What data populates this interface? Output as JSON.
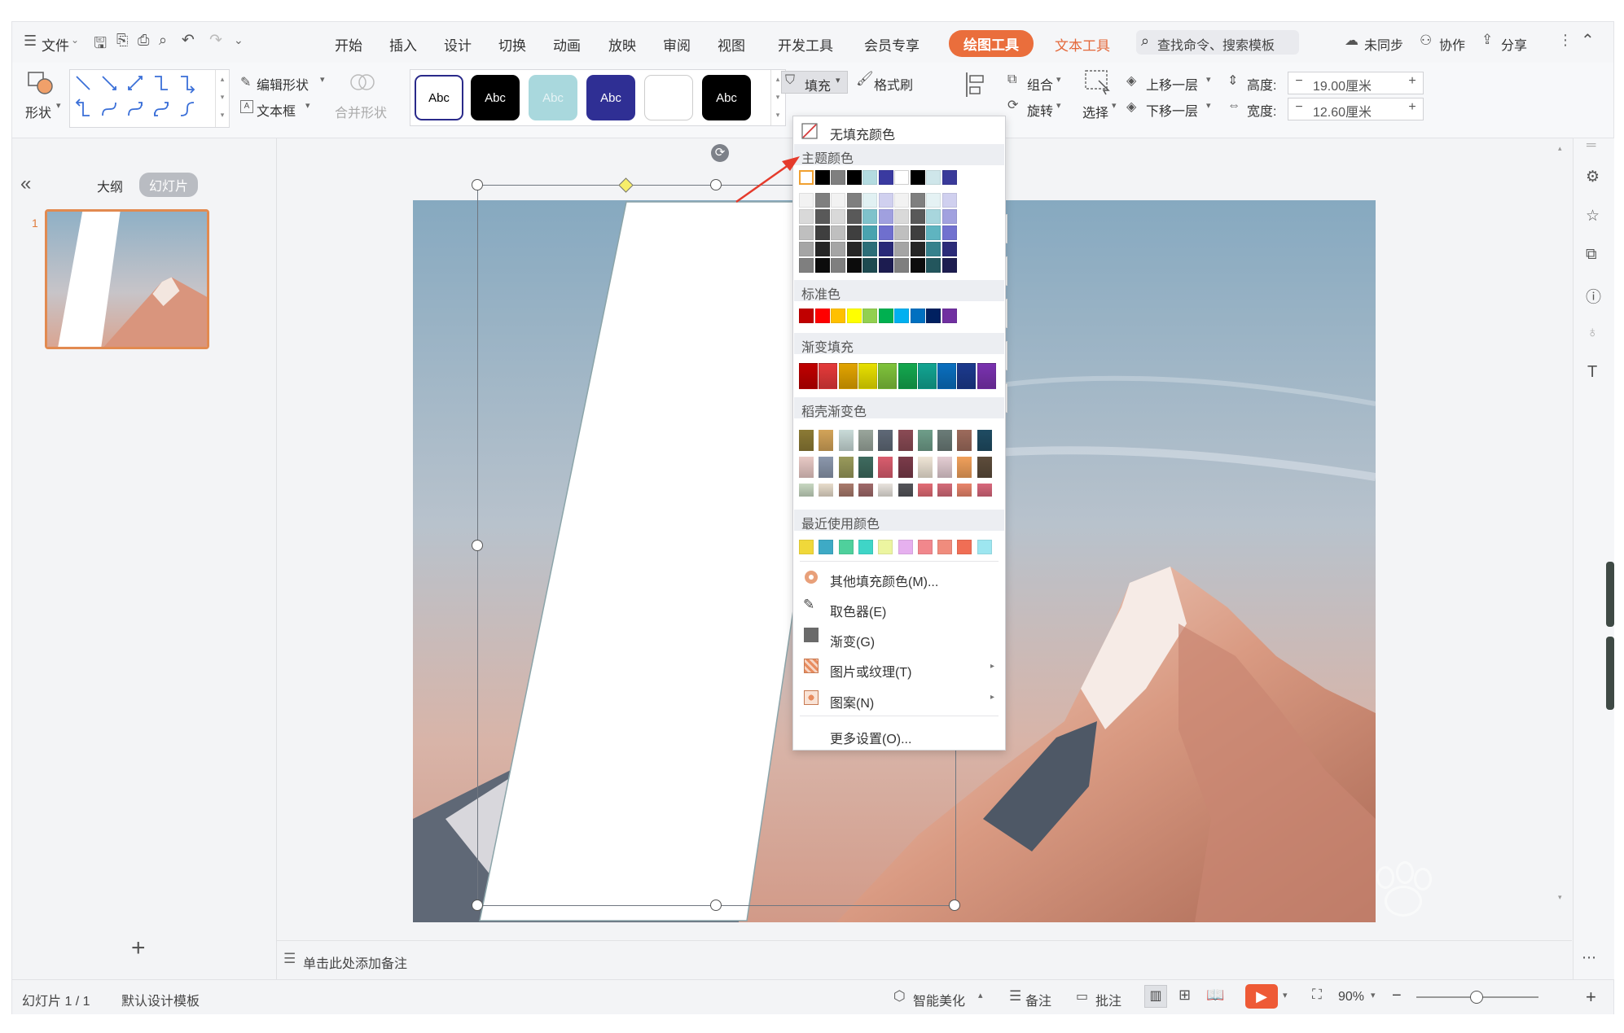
{
  "menubar": {
    "file": "文件",
    "tabs": [
      "开始",
      "插入",
      "设计",
      "切换",
      "动画",
      "放映",
      "审阅",
      "视图",
      "开发工具",
      "会员专享"
    ],
    "drawing_tools": "绘图工具",
    "text_tools": "文本工具",
    "search_placeholder": "查找命令、搜索模板",
    "sync": "未同步",
    "collab": "协作",
    "share": "分享"
  },
  "ribbon": {
    "shape": "形状",
    "edit_shape": "编辑形状",
    "textbox": "文本框",
    "merge_shape": "合并形状",
    "style_label": "Abc",
    "fill": "填充",
    "format_painter": "格式刷",
    "group": "组合",
    "rotate": "旋转",
    "select": "选择",
    "bring_forward": "上移一层",
    "send_backward": "下移一层",
    "height_label": "高度:",
    "height_value": "19.00厘米",
    "width_label": "宽度:",
    "width_value": "12.60厘米",
    "minus": "−",
    "plus": "+"
  },
  "leftpanel": {
    "collapse": "«",
    "outline_tab": "大纲",
    "slides_tab": "幻灯片",
    "slide_number": "1",
    "add": "+"
  },
  "notes_placeholder": "单击此处添加备注",
  "statusbar": {
    "slide_counter": "幻灯片 1 / 1",
    "template": "默认设计模板",
    "smart_beautify": "智能美化",
    "notes": "备注",
    "comments": "批注",
    "zoom": "90%",
    "zoom_minus": "−",
    "zoom_plus": "+"
  },
  "fill_menu": {
    "no_fill": "无填充颜色",
    "theme_colors": "主题颜色",
    "standard_colors": "标准色",
    "gradient_fill": "渐变填充",
    "docer_gradient": "稻壳渐变色",
    "recent_colors": "最近使用颜色",
    "more_colors": "其他填充颜色(M)...",
    "eyedropper": "取色器(E)",
    "gradient": "渐变(G)",
    "picture_texture": "图片或纹理(T)",
    "pattern": "图案(N)",
    "more_settings": "更多设置(O)...",
    "theme_row": [
      "#ffffff",
      "#000000",
      "#7f7f7f",
      "#000000",
      "#b3dbe0",
      "#3a3aa0",
      "#ffffff",
      "#000000",
      "#cfe6ea",
      "#3a3a9a"
    ],
    "theme_shades": [
      [
        "#f2f2f2",
        "#7f7f7f",
        "#f2f2f2",
        "#7f7f7f",
        "#e1f1f3",
        "#d0d0ef",
        "#f2f2f2",
        "#7f7f7f",
        "#e5f2f4",
        "#d0d0ef"
      ],
      [
        "#d9d9d9",
        "#595959",
        "#d9d9d9",
        "#595959",
        "#7fc2cb",
        "#a0a0df",
        "#d9d9d9",
        "#595959",
        "#a8d6dd",
        "#a1a1df"
      ],
      [
        "#bfbfbf",
        "#3f3f3f",
        "#bfbfbf",
        "#3f3f3f",
        "#4aa3af",
        "#6f6fce",
        "#bfbfbf",
        "#3f3f3f",
        "#5fb4c0",
        "#7171cf"
      ],
      [
        "#a5a5a5",
        "#262626",
        "#a5a5a5",
        "#262626",
        "#2c6e78",
        "#2a2a78",
        "#a5a5a5",
        "#262626",
        "#36818c",
        "#2b2b78"
      ],
      [
        "#7f7f7f",
        "#0c0c0c",
        "#7f7f7f",
        "#0c0c0c",
        "#1d4a50",
        "#1c1c50",
        "#7f7f7f",
        "#0c0c0c",
        "#23565d",
        "#1d1d50"
      ]
    ],
    "standard_row": [
      "#c00000",
      "#ff0000",
      "#ffc000",
      "#ffff00",
      "#92d050",
      "#00b050",
      "#00b0f0",
      "#0070c0",
      "#002060",
      "#7030a0"
    ],
    "gradient_row": [
      "#c00000",
      "#e53a3a",
      "#e2a400",
      "#e8e000",
      "#7fc33b",
      "#14a84f",
      "#12a592",
      "#0a6fbf",
      "#1c3a8e",
      "#7a32b0"
    ],
    "docer_rows": [
      [
        "#8c7a35",
        "#d3a459",
        "#c9dbd8",
        "#9aa69c",
        "#5f6977",
        "#8b4b55",
        "#6f9e8a",
        "#6b7c78",
        "#9d6b5c",
        "#1f4c63"
      ],
      [
        "#e8c9c5",
        "#8b97ac",
        "#999a5b",
        "#3f6b5f",
        "#d95d6e",
        "#7b3b4a",
        "#efe5d6",
        "#e4cdd3",
        "#f0a05b",
        "#5d4c3b"
      ],
      [
        "#c7d7c1",
        "#e7dccb",
        "#a97b6d",
        "#a06a6a",
        "#e8e3dd",
        "#55555a",
        "#e26c75",
        "#d46b79",
        "#e8856b",
        "#d8687c"
      ]
    ],
    "recent_row": [
      "#f0d83a",
      "#3eaac5",
      "#4fd09c",
      "#3fd5c7",
      "#ecf5a0",
      "#e6b0ef",
      "#f1878c",
      "#f08c7d",
      "#f06e55",
      "#9de6f0"
    ]
  }
}
